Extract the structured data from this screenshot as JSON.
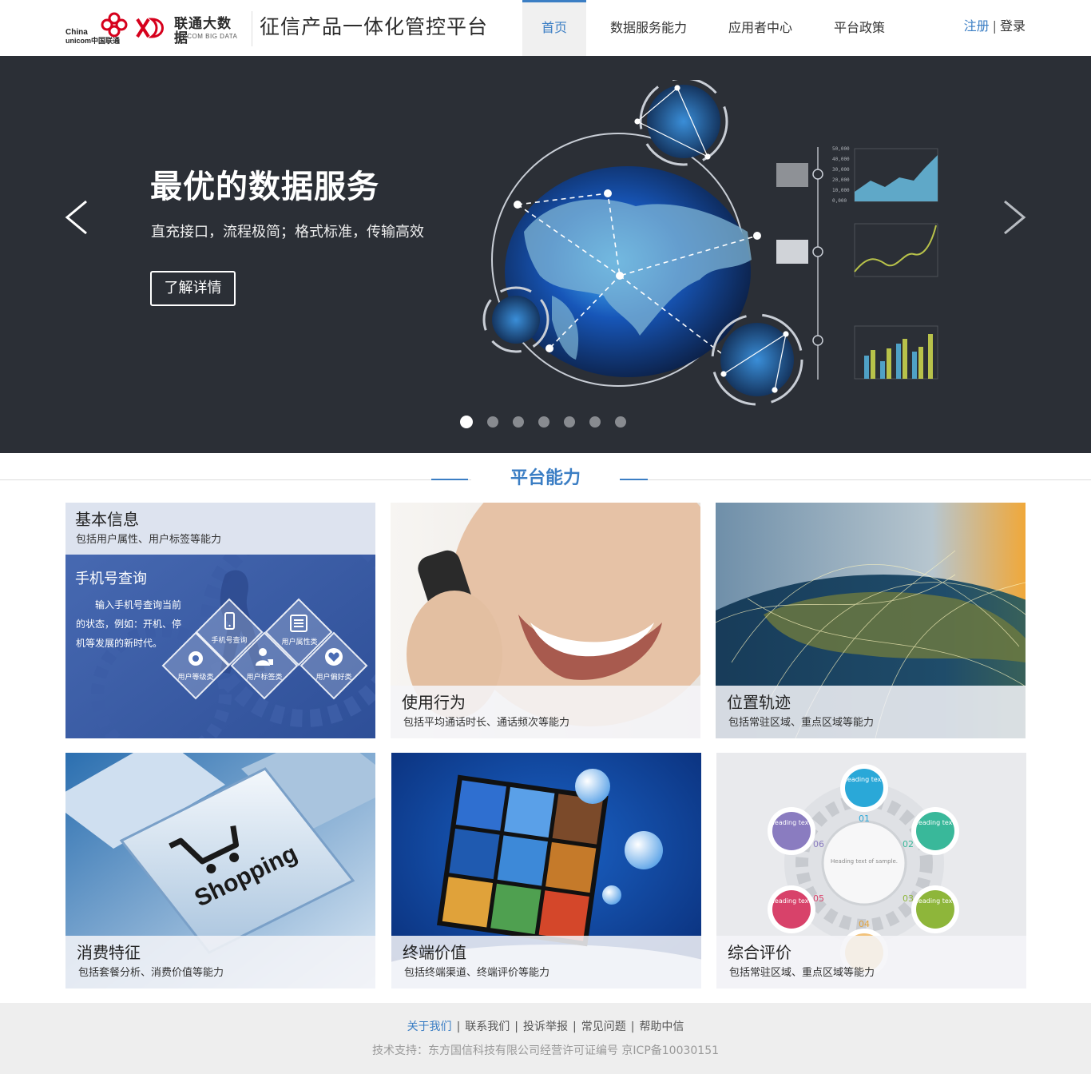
{
  "header": {
    "logo": {
      "china": "China",
      "unicom": "unicom中国联通",
      "brand_cn": "联通大数据",
      "brand_en": "UNICOM BIG DATA"
    },
    "site_title": "征信产品一体化管控平台",
    "nav": [
      "首页",
      "数据服务能力",
      "应用者中心",
      "平台政策"
    ],
    "active_nav": "首页",
    "auth": {
      "register": "注册",
      "separator": "|",
      "login": "登录"
    }
  },
  "banner": {
    "headline": "最优的数据服务",
    "subline": "直充接口，流程极简；格式标准，传输高效",
    "button": "了解详情",
    "active_slide": 1,
    "slide_count": 7,
    "chart_axis_labels": [
      "50,000",
      "40,000",
      "30,000",
      "20,000",
      "10,000",
      "0,000"
    ]
  },
  "section": {
    "title": "平台能力"
  },
  "cards": [
    {
      "title": "基本信息",
      "desc": "包括用户属性、用户标签等能力",
      "inner_title": "手机号查询",
      "inner_desc": "输入手机号查询当前的状态，例如：开机、停机等发展的新时代。",
      "diamonds": [
        "手机号查询",
        "用户属性类",
        "用户等级类",
        "用户标签类",
        "用户偏好类"
      ]
    },
    {
      "title": "使用行为",
      "desc": "包括平均通话时长、通话频次等能力"
    },
    {
      "title": "位置轨迹",
      "desc": "包括常驻区域、重点区域等能力"
    },
    {
      "title": "消费特征",
      "desc": "包括套餐分析、消费价值等能力",
      "key_text": "Shopping"
    },
    {
      "title": "终端价值",
      "desc": "包括终端渠道、终端评价等能力"
    },
    {
      "title": "综合评价",
      "desc": "包括常驻区域、重点区域等能力",
      "infographic_numbers": [
        "01",
        "02",
        "03",
        "04",
        "05",
        "06"
      ],
      "infographic_heading": "Heading text.",
      "infographic_center": "Heading text of sample."
    }
  ],
  "footer": {
    "links": [
      "关于我们",
      "联系我们",
      "投诉举报",
      "常见问题",
      "帮助中信"
    ],
    "copyright": "技术支持：东方国信科技有限公司经营许可证编号  京ICP备10030151"
  },
  "colors": {
    "accent": "#3b7ec4",
    "banner_bg": "#2b2f36",
    "footer_bg": "#eeeeee"
  }
}
